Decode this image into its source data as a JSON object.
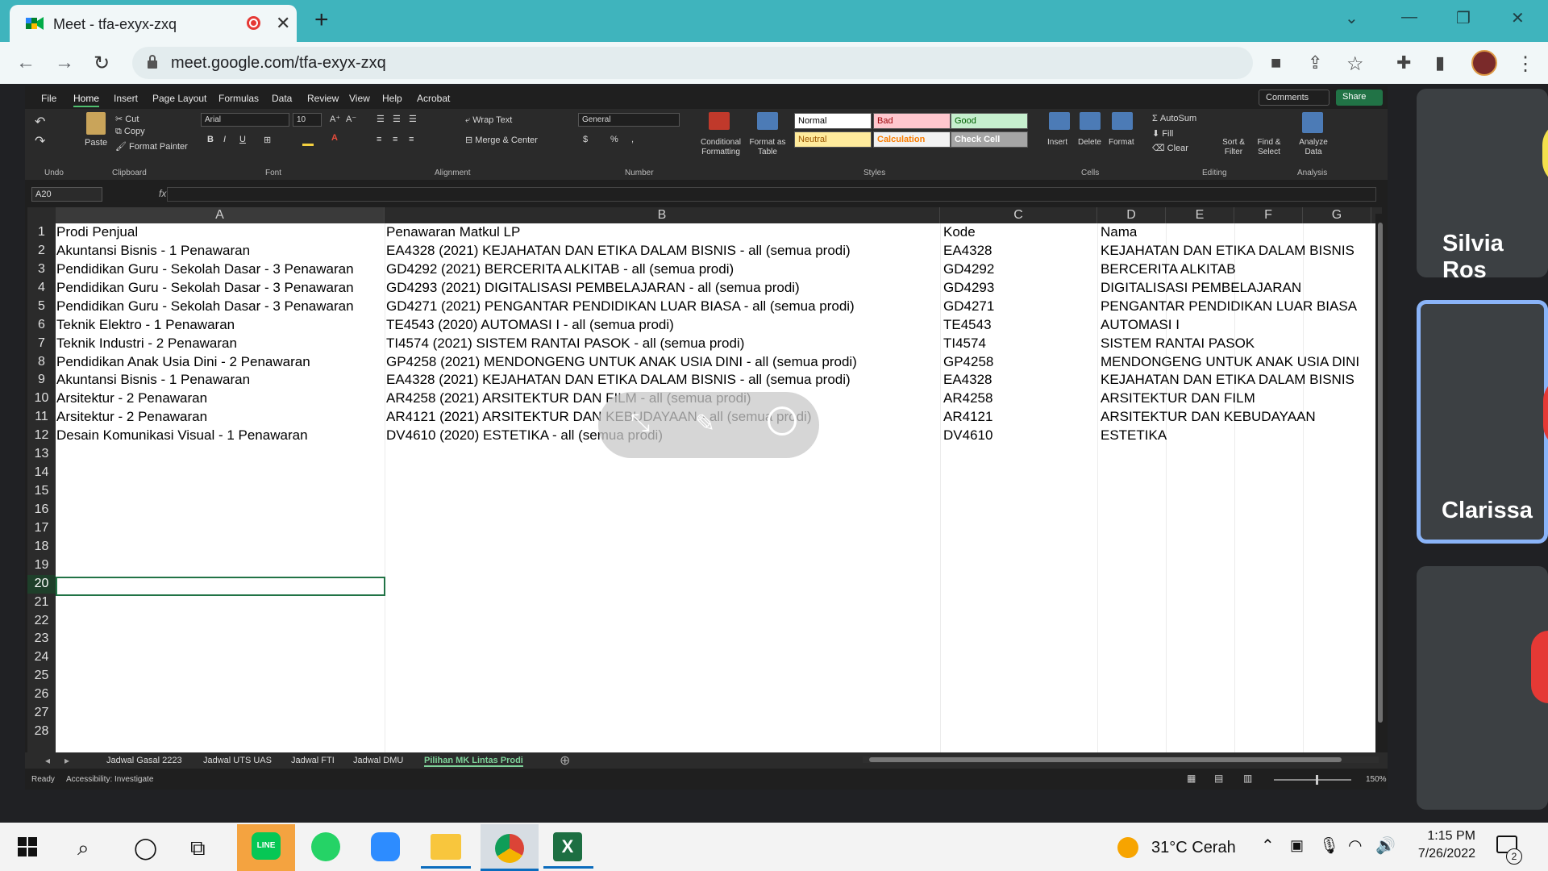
{
  "browser": {
    "tab_title": "Meet - tfa-exyx-zxq",
    "tab_close": "✕",
    "new_tab": "+",
    "url": "meet.google.com/tfa-exyx-zxq",
    "nav": {
      "back": "←",
      "forward": "→",
      "reload": "↻"
    },
    "window": {
      "dropdown": "⌄",
      "minimize": "—",
      "restore": "❐",
      "close": "✕"
    },
    "icons": {
      "camera": "■",
      "share": "⇪",
      "star": "☆",
      "extensions": "✚",
      "sidebar": "▮",
      "menu": "⋮"
    }
  },
  "excel": {
    "menu": [
      "File",
      "Home",
      "Insert",
      "Page Layout",
      "Formulas",
      "Data",
      "Review",
      "View",
      "Help",
      "Acrobat"
    ],
    "comments": "Comments",
    "share": "Share",
    "ribbon": {
      "undo": "Undo",
      "paste": "Paste",
      "cut": "Cut",
      "copy": "Copy",
      "format_painter": "Format Painter",
      "clipboard": "Clipboard",
      "font_name": "Arial",
      "font_size": "10",
      "font": "Font",
      "bold": "B",
      "italic": "I",
      "underline": "U",
      "wrap_text": "Wrap Text",
      "merge_center": "Merge & Center",
      "alignment": "Alignment",
      "number_format": "General",
      "number": "Number",
      "conditional": "Conditional Formatting",
      "format_table": "Format as Table",
      "styles": {
        "normal": "Normal",
        "bad": "Bad",
        "good": "Good",
        "neutral": "Neutral",
        "calculation": "Calculation",
        "check_cell": "Check Cell",
        "label": "Styles"
      },
      "insert": "Insert",
      "delete": "Delete",
      "format": "Format",
      "cells": "Cells",
      "autosum": "AutoSum",
      "fill": "Fill",
      "clear": "Clear",
      "sort_filter": "Sort & Filter",
      "find_select": "Find & Select",
      "editing": "Editing",
      "analyze": "Analyze Data",
      "analysis": "Analysis"
    },
    "name_box": "A20",
    "fx": "fx",
    "columns": [
      "A",
      "B",
      "C",
      "D",
      "E",
      "F",
      "G"
    ],
    "rows": [
      [
        "Prodi Penjual",
        "Penawaran Matkul LP",
        "Kode",
        "Nama"
      ],
      [
        "Akuntansi Bisnis  - 1 Penawaran",
        "EA4328 (2021) KEJAHATAN DAN ETIKA DALAM BISNIS - all (semua prodi)",
        "EA4328",
        "KEJAHATAN DAN ETIKA DALAM BISNIS"
      ],
      [
        "Pendidikan Guru - Sekolah Dasar  - 3 Penawaran",
        "GD4292 (2021) BERCERITA ALKITAB - all (semua prodi)",
        "GD4292",
        "BERCERITA ALKITAB"
      ],
      [
        "Pendidikan Guru - Sekolah Dasar  - 3 Penawaran",
        "GD4293 (2021) DIGITALISASI PEMBELAJARAN - all (semua prodi)",
        "GD4293",
        "DIGITALISASI PEMBELAJARAN"
      ],
      [
        "Pendidikan Guru - Sekolah Dasar  - 3 Penawaran",
        "GD4271 (2021) PENGANTAR PENDIDIKAN LUAR BIASA - all (semua prodi)",
        "GD4271",
        "PENGANTAR PENDIDIKAN LUAR BIASA"
      ],
      [
        "Teknik Elektro  - 1 Penawaran",
        "TE4543 (2020) AUTOMASI I - all (semua prodi)",
        "TE4543",
        "AUTOMASI I"
      ],
      [
        "Teknik Industri  - 2 Penawaran",
        "TI4574 (2021) SISTEM RANTAI PASOK - all (semua prodi)",
        "TI4574",
        "SISTEM RANTAI PASOK"
      ],
      [
        "Pendidikan Anak Usia Dini  - 2 Penawaran",
        "GP4258 (2021) MENDONGENG UNTUK ANAK USIA DINI - all (semua prodi)",
        "GP4258",
        "MENDONGENG UNTUK ANAK USIA DINI"
      ],
      [
        "Akuntansi Bisnis  - 1 Penawaran",
        "EA4328 (2021) KEJAHATAN DAN ETIKA DALAM BISNIS - all (semua prodi)",
        "EA4328",
        "KEJAHATAN DAN ETIKA DALAM BISNIS"
      ],
      [
        "Arsitektur  - 2 Penawaran",
        "AR4258 (2021) ARSITEKTUR DAN FILM - all (semua prodi)",
        "AR4258",
        "ARSITEKTUR DAN FILM"
      ],
      [
        "Arsitektur  - 2 Penawaran",
        "AR4121 (2021) ARSITEKTUR DAN KEBUDAYAAN - all (semua prodi)",
        "AR4121",
        "ARSITEKTUR DAN KEBUDAYAAN"
      ],
      [
        "Desain Komunikasi Visual  - 1 Penawaran",
        "DV4610 (2020) ESTETIKA - all (semua prodi)",
        "DV4610",
        "ESTETIKA"
      ]
    ],
    "row_numbers": [
      "1",
      "2",
      "3",
      "4",
      "5",
      "6",
      "7",
      "8",
      "9",
      "10",
      "11",
      "12",
      "13",
      "14",
      "15",
      "16",
      "17",
      "18",
      "19",
      "20",
      "21",
      "22",
      "23",
      "24",
      "25",
      "26",
      "27",
      "28"
    ],
    "selected_row": "20",
    "sheet_tabs": [
      "Jadwal Gasal 2223",
      "Jadwal UTS UAS",
      "Jadwal FTI",
      "Jadwal DMU",
      "Pilihan MK Lintas Prodi"
    ],
    "active_sheet": "Pilihan MK Lintas Prodi",
    "status_ready": "Ready",
    "accessibility": "Accessibility: Investigate",
    "zoom": "150%"
  },
  "meet": {
    "participants": [
      "Silvia Ros",
      "Clarissa"
    ]
  },
  "taskbar": {
    "weather": "31°C  Cerah",
    "time": "1:15 PM",
    "date": "7/26/2022",
    "notifications": "2"
  }
}
